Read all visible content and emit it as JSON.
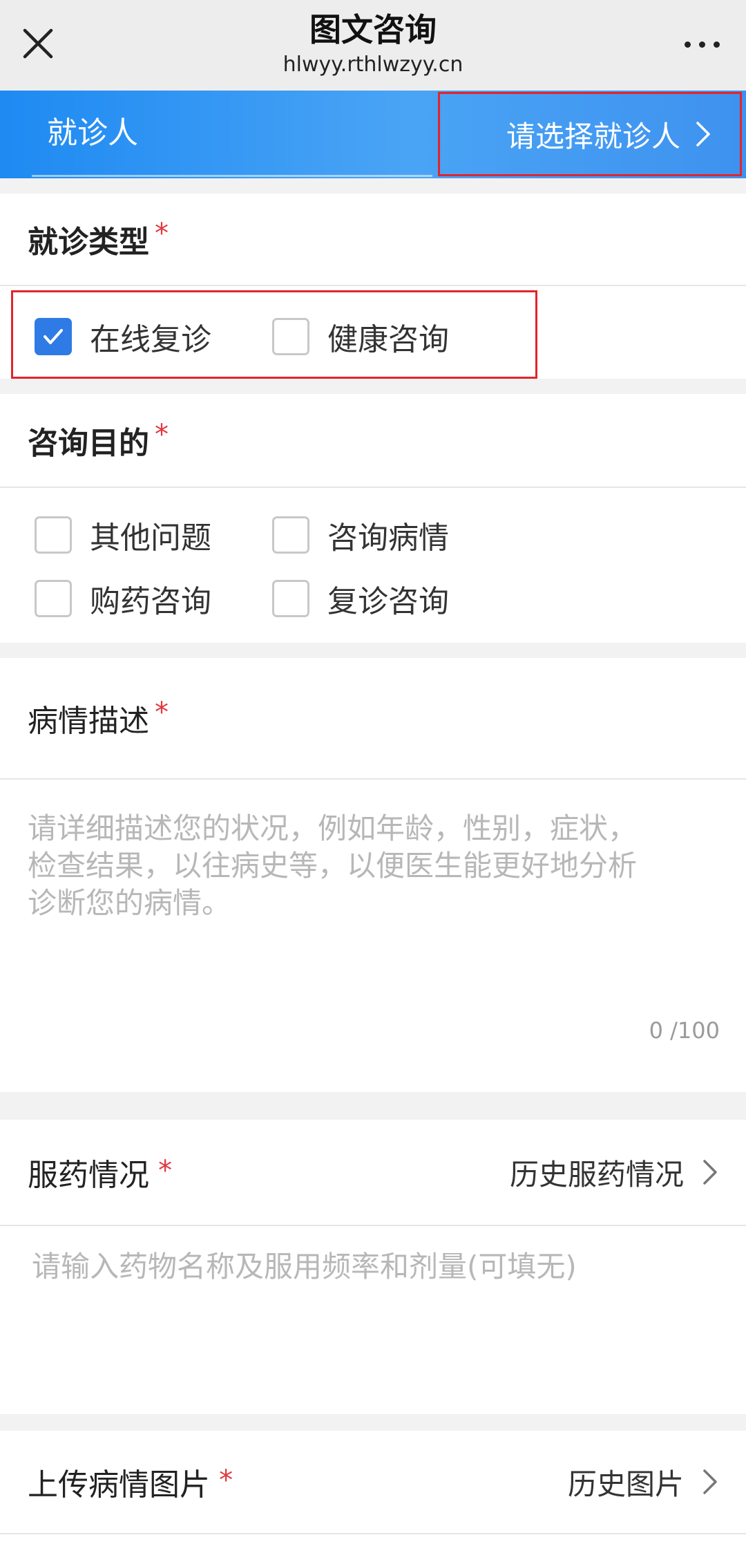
{
  "titlebar": {
    "title": "图文咨询",
    "url": "hlwyy.rthlwzyy.cn"
  },
  "patient": {
    "label": "就诊人",
    "select_text": "请选择就诊人"
  },
  "visit_type": {
    "title": "就诊类型",
    "required": "*",
    "options": [
      {
        "label": "在线复诊",
        "checked": true
      },
      {
        "label": "健康咨询",
        "checked": false
      }
    ]
  },
  "purpose": {
    "title": "咨询目的",
    "required": "*",
    "options": [
      {
        "label": "其他问题",
        "checked": false
      },
      {
        "label": "咨询病情",
        "checked": false
      },
      {
        "label": "购药咨询",
        "checked": false
      },
      {
        "label": "复诊咨询",
        "checked": false
      }
    ]
  },
  "description": {
    "title": "病情描述",
    "required": "*",
    "placeholder_line1": "请详细描述您的状况，例如年龄，性别，症状，",
    "placeholder_line2": "检查结果，以往病史等，以便医生能更好地分析",
    "placeholder_line3": "诊断您的病情。",
    "counter": "0 /100"
  },
  "medication": {
    "title": "服药情况",
    "required": "*",
    "history_link": "历史服药情况",
    "placeholder": "请输入药物名称及服用频率和剂量(可填无)"
  },
  "upload": {
    "title": "上传病情图片",
    "required": "*",
    "history_link": "历史图片"
  },
  "colors": {
    "accent": "#2f7be5",
    "header_gradient_start": "#1e8af2",
    "highlight_box": "#e3242b",
    "required_star": "#e0383e"
  }
}
